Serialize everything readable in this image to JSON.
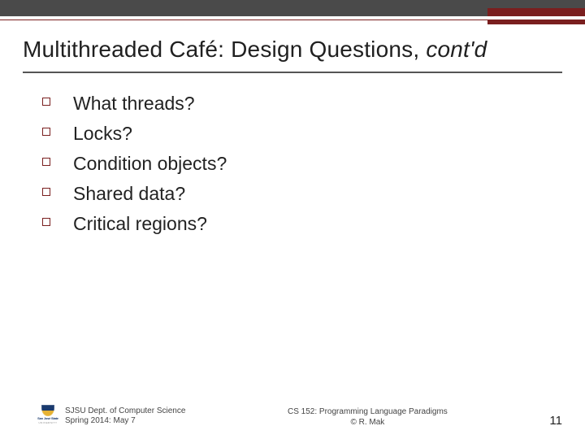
{
  "title_main": "Multithreaded Café: Design Questions, ",
  "title_italic": "cont'd",
  "bullets": {
    "items": [
      {
        "text": "What threads?"
      },
      {
        "text": "Locks?"
      },
      {
        "text": "Condition objects?"
      },
      {
        "text": "Shared data?"
      },
      {
        "text": "Critical regions?"
      }
    ]
  },
  "footer": {
    "left_line1": "SJSU Dept. of Computer Science",
    "left_line2": "Spring 2014: May 7",
    "center_line1": "CS 152: Programming Language Paradigms",
    "center_line2": "© R. Mak",
    "page": "11",
    "logo_label": "San José State",
    "logo_sub": "UNIVERSITY"
  }
}
